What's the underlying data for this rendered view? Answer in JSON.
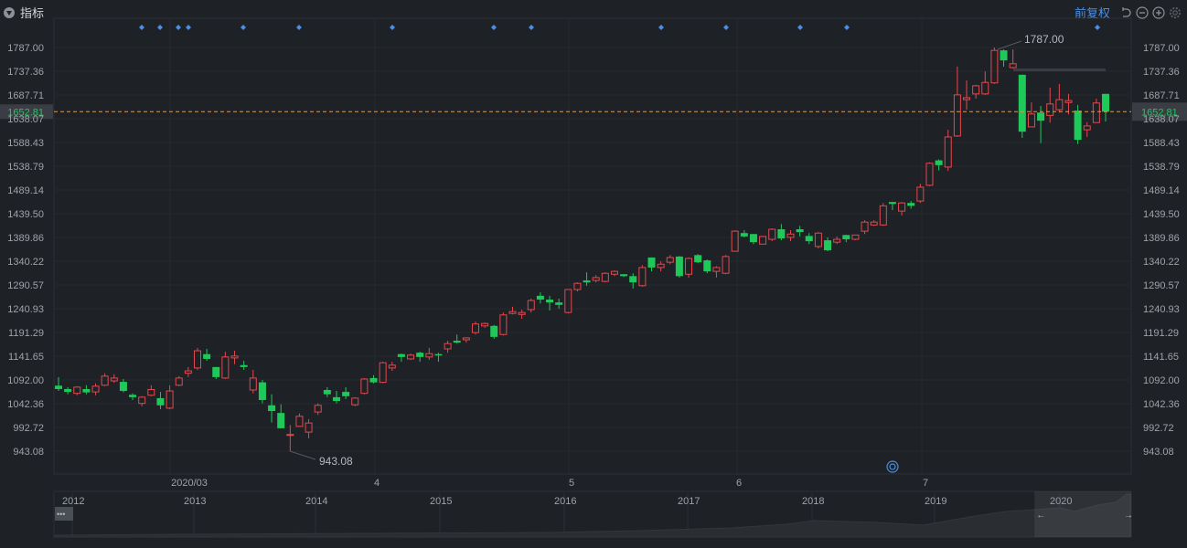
{
  "header": {
    "indicator_label": "指标",
    "adjust_label": "前复权",
    "icons": [
      "caret-down-circle-icon",
      "undo-icon",
      "zoom-out-icon",
      "zoom-in-icon",
      "settings-gear-icon"
    ]
  },
  "colors": {
    "background": "#1e2125",
    "up": "#e5484d",
    "down": "#1ec95a",
    "last_price_line": "#d99a5b",
    "accent": "#4a90e2"
  },
  "chart_data": {
    "type": "candlestick",
    "y_ticks": [
      "1787.00",
      "1737.36",
      "1687.71",
      "1638.07",
      "1588.43",
      "1538.79",
      "1489.14",
      "1439.50",
      "1389.86",
      "1340.22",
      "1290.57",
      "1240.93",
      "1191.29",
      "1141.65",
      "1092.00",
      "1042.36",
      "992.72",
      "943.08"
    ],
    "ylim": [
      943.08,
      1787.0
    ],
    "grid": true,
    "x_ticks": [
      "2020/03",
      "4",
      "5",
      "6",
      "7"
    ],
    "last_price": "1652.81",
    "max_label": "1787.00",
    "min_label": "943.08",
    "candle_fields": [
      "open",
      "high",
      "low",
      "close"
    ],
    "candles": [
      [
        1080,
        1098,
        1069,
        1073
      ],
      [
        1073,
        1077,
        1062,
        1067
      ],
      [
        1064,
        1079,
        1060,
        1077
      ],
      [
        1073,
        1081,
        1062,
        1066
      ],
      [
        1067,
        1085,
        1060,
        1079
      ],
      [
        1081,
        1106,
        1079,
        1100
      ],
      [
        1090,
        1104,
        1086,
        1096
      ],
      [
        1088,
        1094,
        1066,
        1069
      ],
      [
        1061,
        1064,
        1050,
        1056
      ],
      [
        1043,
        1058,
        1037,
        1056
      ],
      [
        1060,
        1081,
        1058,
        1072
      ],
      [
        1054,
        1067,
        1031,
        1039
      ],
      [
        1033,
        1081,
        1031,
        1069
      ],
      [
        1081,
        1100,
        1079,
        1096
      ],
      [
        1106,
        1119,
        1098,
        1111
      ],
      [
        1117,
        1159,
        1113,
        1153
      ],
      [
        1146,
        1157,
        1132,
        1136
      ],
      [
        1119,
        1119,
        1094,
        1098
      ],
      [
        1096,
        1151,
        1094,
        1140
      ],
      [
        1138,
        1153,
        1125,
        1142
      ],
      [
        1123,
        1132,
        1113,
        1119
      ],
      [
        1071,
        1113,
        1064,
        1096
      ],
      [
        1087,
        1092,
        1043,
        1050
      ],
      [
        1039,
        1062,
        1003,
        1027
      ],
      [
        1023,
        1041,
        991,
        991
      ],
      [
        976,
        998,
        943.08,
        978
      ],
      [
        995,
        1022,
        995,
        1016
      ],
      [
        983,
        1010,
        970,
        1002
      ],
      [
        1025,
        1043,
        1019,
        1039
      ],
      [
        1071,
        1077,
        1056,
        1062
      ],
      [
        1056,
        1069,
        1043,
        1048
      ],
      [
        1067,
        1077,
        1052,
        1058
      ],
      [
        1040,
        1056,
        1037,
        1054
      ],
      [
        1064,
        1096,
        1062,
        1094
      ],
      [
        1096,
        1102,
        1085,
        1087
      ],
      [
        1087,
        1130,
        1085,
        1128
      ],
      [
        1117,
        1130,
        1111,
        1123
      ],
      [
        1146,
        1147,
        1130,
        1140
      ],
      [
        1136,
        1147,
        1134,
        1144
      ],
      [
        1149,
        1151,
        1130,
        1140
      ],
      [
        1140,
        1159,
        1134,
        1147
      ],
      [
        1146,
        1149,
        1130,
        1144
      ],
      [
        1157,
        1174,
        1149,
        1168
      ],
      [
        1174,
        1187,
        1168,
        1170
      ],
      [
        1176,
        1181,
        1170,
        1180
      ],
      [
        1191,
        1214,
        1187,
        1209
      ],
      [
        1205,
        1212,
        1201,
        1210
      ],
      [
        1205,
        1207,
        1178,
        1182
      ],
      [
        1187,
        1233,
        1185,
        1228
      ],
      [
        1231,
        1245,
        1229,
        1235
      ],
      [
        1229,
        1239,
        1220,
        1233
      ],
      [
        1239,
        1262,
        1233,
        1258
      ],
      [
        1268,
        1275,
        1252,
        1260
      ],
      [
        1260,
        1268,
        1237,
        1254
      ],
      [
        1254,
        1262,
        1241,
        1249
      ],
      [
        1233,
        1281,
        1231,
        1281
      ],
      [
        1281,
        1296,
        1277,
        1294
      ],
      [
        1300,
        1317,
        1289,
        1296
      ],
      [
        1300,
        1311,
        1296,
        1306
      ],
      [
        1298,
        1317,
        1296,
        1315
      ],
      [
        1313,
        1321,
        1309,
        1319
      ],
      [
        1313,
        1313,
        1307,
        1309
      ],
      [
        1309,
        1315,
        1283,
        1296
      ],
      [
        1289,
        1332,
        1287,
        1327
      ],
      [
        1348,
        1348,
        1319,
        1327
      ],
      [
        1327,
        1340,
        1319,
        1334
      ],
      [
        1338,
        1353,
        1334,
        1348
      ],
      [
        1350,
        1351,
        1306,
        1309
      ],
      [
        1313,
        1348,
        1306,
        1346
      ],
      [
        1353,
        1355,
        1336,
        1338
      ],
      [
        1342,
        1344,
        1315,
        1319
      ],
      [
        1319,
        1330,
        1306,
        1327
      ],
      [
        1315,
        1353,
        1313,
        1350
      ],
      [
        1361,
        1405,
        1361,
        1403
      ],
      [
        1399,
        1405,
        1390,
        1392
      ],
      [
        1397,
        1397,
        1376,
        1380
      ],
      [
        1376,
        1393,
        1376,
        1392
      ],
      [
        1386,
        1409,
        1382,
        1407
      ],
      [
        1407,
        1418,
        1384,
        1388
      ],
      [
        1390,
        1405,
        1382,
        1397
      ],
      [
        1407,
        1414,
        1392,
        1401
      ],
      [
        1393,
        1399,
        1376,
        1382
      ],
      [
        1371,
        1401,
        1367,
        1399
      ],
      [
        1384,
        1390,
        1361,
        1363
      ],
      [
        1380,
        1392,
        1376,
        1386
      ],
      [
        1395,
        1395,
        1380,
        1386
      ],
      [
        1386,
        1395,
        1384,
        1395
      ],
      [
        1403,
        1426,
        1397,
        1422
      ],
      [
        1416,
        1426,
        1414,
        1422
      ],
      [
        1416,
        1462,
        1414,
        1456
      ],
      [
        1464,
        1464,
        1447,
        1460
      ],
      [
        1445,
        1464,
        1436,
        1462
      ],
      [
        1462,
        1466,
        1450,
        1456
      ],
      [
        1466,
        1502,
        1462,
        1495
      ],
      [
        1499,
        1547,
        1497,
        1545
      ],
      [
        1551,
        1553,
        1530,
        1541
      ],
      [
        1537,
        1615,
        1529,
        1600
      ],
      [
        1602,
        1747,
        1600,
        1688
      ],
      [
        1678,
        1718,
        1657,
        1682
      ],
      [
        1690,
        1709,
        1680,
        1707
      ],
      [
        1690,
        1737,
        1688,
        1714
      ],
      [
        1713,
        1787,
        1711,
        1781
      ],
      [
        1781,
        1783,
        1747,
        1760
      ],
      [
        1745,
        1783,
        1743,
        1753
      ],
      [
        1730,
        1730,
        1598,
        1611
      ],
      [
        1621,
        1672,
        1621,
        1648
      ],
      [
        1651,
        1665,
        1587,
        1634
      ],
      [
        1645,
        1703,
        1630,
        1669
      ],
      [
        1657,
        1711,
        1651,
        1678
      ],
      [
        1672,
        1690,
        1647,
        1676
      ],
      [
        1655,
        1667,
        1585,
        1594
      ],
      [
        1615,
        1631,
        1600,
        1623
      ],
      [
        1630,
        1680,
        1630,
        1671
      ],
      [
        1690,
        1690,
        1632,
        1652.81
      ]
    ],
    "event_markers_count": 14
  },
  "navigator": {
    "year_labels": [
      "2012",
      "2013",
      "2014",
      "2015",
      "2016",
      "2017",
      "2018",
      "2019",
      "2020"
    ],
    "handle_label": "•••",
    "left_arrow": "←",
    "right_arrow": "→",
    "selected_range_fraction": [
      0.9,
      1.0
    ]
  }
}
